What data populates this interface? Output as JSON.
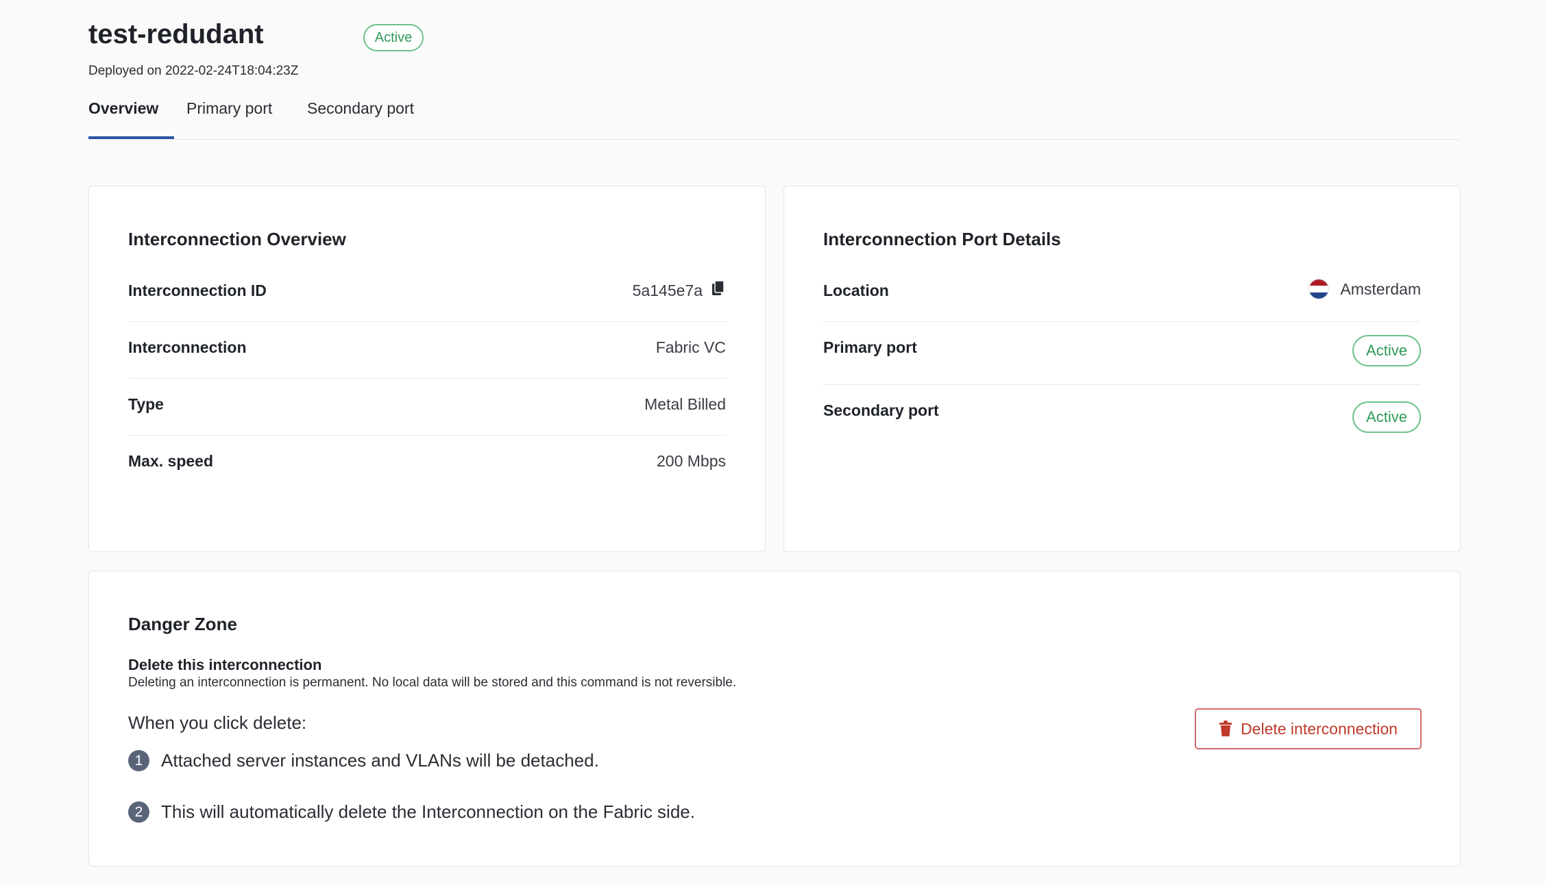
{
  "header": {
    "title": "test-redudant",
    "status": "Active",
    "deployed": "Deployed on 2022-02-24T18:04:23Z"
  },
  "tabs": [
    {
      "label": "Overview",
      "active": true
    },
    {
      "label": "Primary port",
      "active": false
    },
    {
      "label": "Secondary port",
      "active": false
    }
  ],
  "overview": {
    "title": "Interconnection Overview",
    "rows": [
      {
        "key": "Interconnection ID",
        "value": "5a145e7a",
        "icon": "copy-icon"
      },
      {
        "key": "Interconnection",
        "value": "Fabric VC"
      },
      {
        "key": "Type",
        "value": "Metal Billed"
      },
      {
        "key": "Max. speed",
        "value": "200 Mbps"
      }
    ]
  },
  "port_details": {
    "title": "Interconnection Port Details",
    "location_label": "Location",
    "location_value": "Amsterdam",
    "location_flag": "netherlands-flag-icon",
    "primary_label": "Primary port",
    "primary_status": "Active",
    "secondary_label": "Secondary port",
    "secondary_status": "Active"
  },
  "danger_zone": {
    "title": "Danger Zone",
    "subtitle": "Delete this interconnection",
    "description": "Deleting an interconnection is permanent. No local data will be stored and this command is not reversible.",
    "when_label": "When you click delete:",
    "items": [
      {
        "num": "1",
        "text": "Attached server instances and VLANs will be detached."
      },
      {
        "num": "2",
        "text": "This will automatically delete the Interconnection on the Fabric side."
      }
    ],
    "delete_button": "Delete interconnection"
  },
  "colors": {
    "accent": "#2a55a3",
    "active_green": "#2e9a57",
    "danger_red": "#c0392b",
    "badge_num": "#5a6479",
    "flag_red": "#ae1c28",
    "flag_white": "#ffffff",
    "flag_blue": "#21468b"
  }
}
